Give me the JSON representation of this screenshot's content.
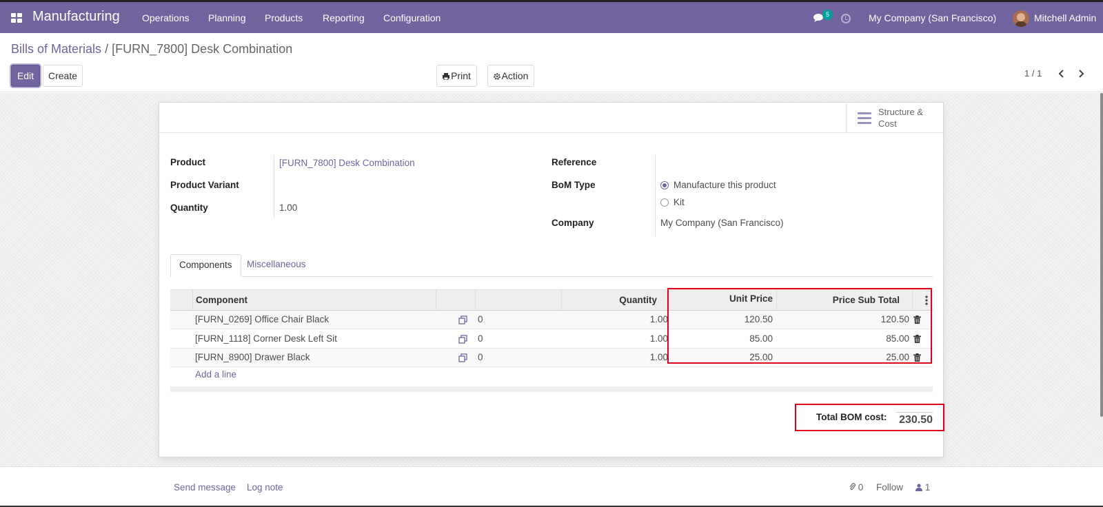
{
  "navbar": {
    "app_name": "Manufacturing",
    "menu": [
      "Operations",
      "Planning",
      "Products",
      "Reporting",
      "Configuration"
    ],
    "messages_count": "5",
    "company": "My Company (San Francisco)",
    "user": "Mitchell Admin"
  },
  "breadcrumb": {
    "parent": "Bills of Materials",
    "separator": "/",
    "current": "[FURN_7800] Desk Combination"
  },
  "buttons": {
    "edit": "Edit",
    "create": "Create",
    "print": "Print",
    "action": "Action"
  },
  "pager": "1 / 1",
  "smart_button": {
    "line1": "Structure &",
    "line2": "Cost",
    "icon": "bars-icon"
  },
  "form": {
    "product_label": "Product",
    "product_value": "[FURN_7800] Desk Combination",
    "variant_label": "Product Variant",
    "variant_value": "",
    "quantity_label": "Quantity",
    "quantity_value": "1.00",
    "reference_label": "Reference",
    "reference_value": "",
    "bom_type_label": "BoM Type",
    "bom_type_options": [
      "Manufacture this product",
      "Kit"
    ],
    "bom_type_selected": "Manufacture this product",
    "company_label": "Company",
    "company_value": "My Company (San Francisco)"
  },
  "tabs": [
    "Components",
    "Miscellaneous"
  ],
  "table": {
    "headers": {
      "component": "Component",
      "quantity": "Quantity",
      "unit_price": "Unit Price",
      "subtotal": "Price Sub Total"
    },
    "rows": [
      {
        "component": "[FURN_0269] Office Chair Black",
        "qty_avail": "0",
        "quantity": "1.00",
        "unit_price": "120.50",
        "subtotal": "120.50"
      },
      {
        "component": "[FURN_1118] Corner Desk Left Sit",
        "qty_avail": "0",
        "quantity": "1.00",
        "unit_price": "85.00",
        "subtotal": "85.00"
      },
      {
        "component": "[FURN_8900] Drawer Black",
        "qty_avail": "0",
        "quantity": "1.00",
        "unit_price": "25.00",
        "subtotal": "25.00"
      }
    ],
    "add_line": "Add a line"
  },
  "total": {
    "label": "Total BOM cost:",
    "value": "230.50"
  },
  "chatter": {
    "send_message": "Send message",
    "log_note": "Log note",
    "attachments": "0",
    "follow": "Follow",
    "followers": "1"
  },
  "colors": {
    "brand": "#71639e",
    "highlight": "#e0001b",
    "badge": "#00a09d"
  }
}
